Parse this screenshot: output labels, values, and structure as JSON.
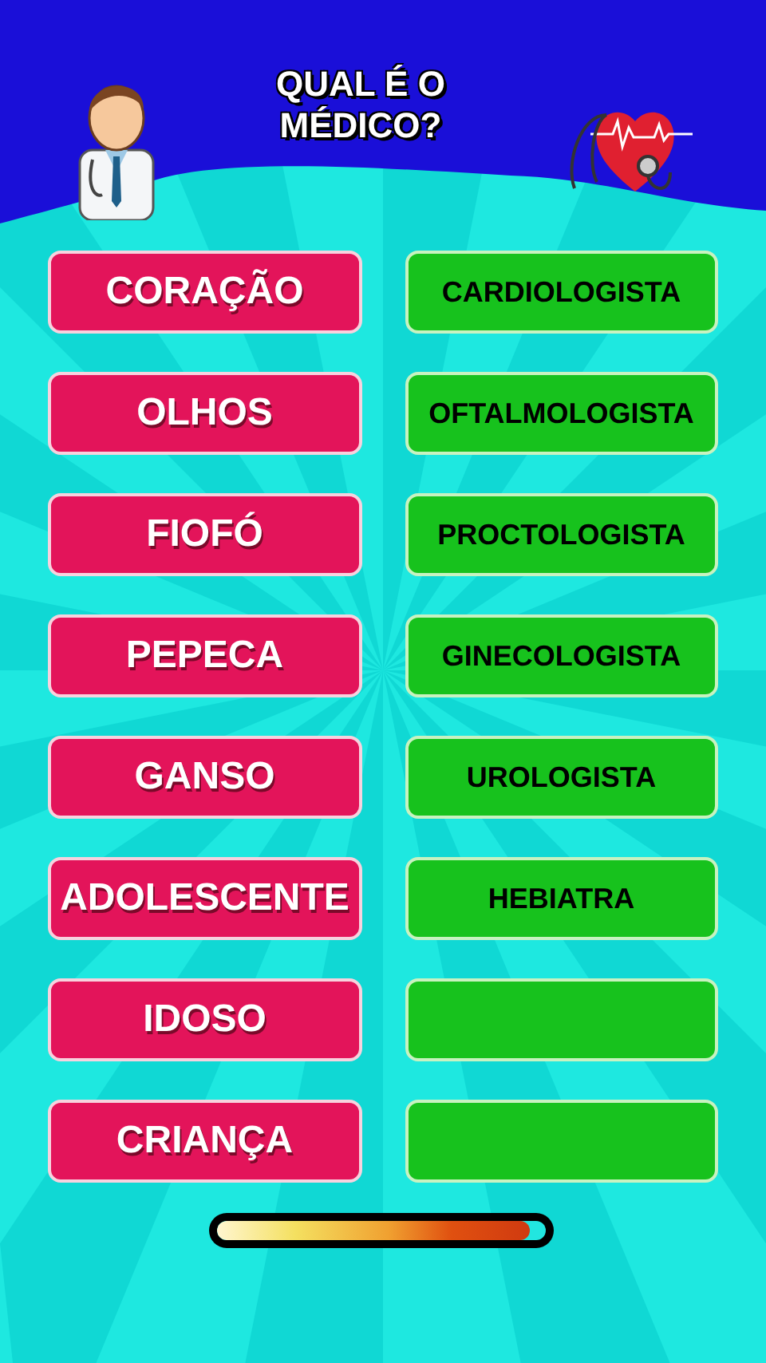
{
  "title": {
    "line_1": "QUAL É O",
    "line_2": "MÉDICO?"
  },
  "pairs": [
    {
      "organ": "CORAÇÃO",
      "answer": "CARDIOLOGISTA"
    },
    {
      "organ": "OLHOS",
      "answer": "OFTALMOLOGISTA"
    },
    {
      "organ": "FIOFÓ",
      "answer": "PROCTOLOGISTA"
    },
    {
      "organ": "PEPECA",
      "answer": "GINECOLOGISTA"
    },
    {
      "organ": "GANSO",
      "answer": "UROLOGISTA"
    },
    {
      "organ": "ADOLESCENTE",
      "answer": "HEBIATRA"
    },
    {
      "organ": "IDOSO"
    },
    {
      "organ": "CRIANÇA"
    }
  ],
  "timer": {
    "level": 0.95
  }
}
